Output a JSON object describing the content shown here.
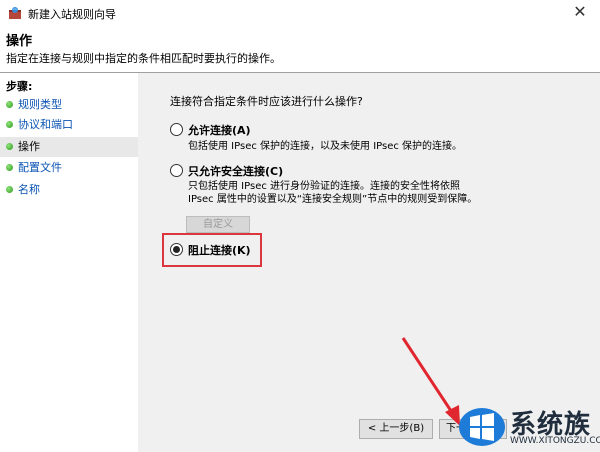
{
  "window": {
    "title": "新建入站规则向导",
    "close_glyph": "✕"
  },
  "header": {
    "title": "操作",
    "description": "指定在连接与规则中指定的条件相匹配时要执行的操作。"
  },
  "steps": {
    "title": "步骤:",
    "items": [
      {
        "label": "规则类型",
        "active": false
      },
      {
        "label": "协议和端口",
        "active": false
      },
      {
        "label": "操作",
        "active": true
      },
      {
        "label": "配置文件",
        "active": false
      },
      {
        "label": "名称",
        "active": false
      }
    ]
  },
  "main": {
    "question": "连接符合指定条件时应该进行什么操作?",
    "options": [
      {
        "label": "允许连接(A)",
        "description": "包括使用 IPsec 保护的连接，以及未使用 IPsec 保护的连接。",
        "checked": false
      },
      {
        "label": "只允许安全连接(C)",
        "description": "只包括使用 IPsec 进行身份验证的连接。连接的安全性将依照 IPsec 属性中的设置以及“连接安全规则”节点中的规则受到保障。",
        "checked": false
      },
      {
        "label": "阻止连接(K)",
        "description": "",
        "checked": true
      }
    ],
    "customize_label": "自定义"
  },
  "buttons": {
    "back": "< 上一步(B)",
    "next": "下一步"
  },
  "watermark": {
    "text": "系统族",
    "url": "WWW.XITONGZU.COM"
  },
  "colors": {
    "highlight": "#d9363e",
    "arrow": "#e0262e",
    "link": "#0b54b3"
  }
}
